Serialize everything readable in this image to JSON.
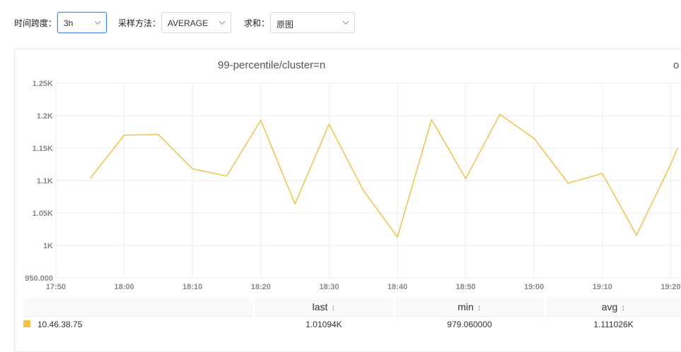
{
  "filters": {
    "range": {
      "label": "时间跨度：",
      "value": "3h"
    },
    "method": {
      "label": "采样方法：",
      "value": "AVERAGE"
    },
    "sum": {
      "label": "求和：",
      "value": "原图"
    }
  },
  "chart_data": {
    "type": "line",
    "title": "99-percentile/cluster=n",
    "title_tail": "o",
    "x_ticks": [
      "17:50",
      "18:00",
      "18:10",
      "18:20",
      "18:30",
      "18:40",
      "18:50",
      "19:00",
      "19:10",
      "19:20"
    ],
    "y_ticks": [
      "950.000",
      "1K",
      "1.05K",
      "1.1K",
      "1.15K",
      "1.2K",
      "1.25K"
    ],
    "ylim": [
      950,
      1250
    ],
    "grid": true,
    "series": [
      {
        "name": "10.46.38.75",
        "color": "#f0c24a",
        "x": [
          "17:55",
          "18:00",
          "18:05",
          "18:10",
          "18:15",
          "18:20",
          "18:25",
          "18:30",
          "18:35",
          "18:40",
          "18:45",
          "18:50",
          "18:55",
          "19:00",
          "19:05",
          "19:10",
          "19:15",
          "19:20",
          "19:21"
        ],
        "values": [
          1103,
          1170,
          1171,
          1118,
          1107,
          1193,
          1064,
          1187,
          1085,
          1013,
          1194,
          1103,
          1202,
          1165,
          1096,
          1111,
          1016,
          1125,
          1150
        ]
      }
    ]
  },
  "legend": {
    "headers": {
      "last": "last",
      "min": "min",
      "avg": "avg"
    },
    "sort_icon": "↕",
    "rows": [
      {
        "name": "10.46.38.75",
        "color": "#f0c24a",
        "last": "1.01094K",
        "min": "979.060000",
        "avg": "1.111026K"
      }
    ]
  }
}
